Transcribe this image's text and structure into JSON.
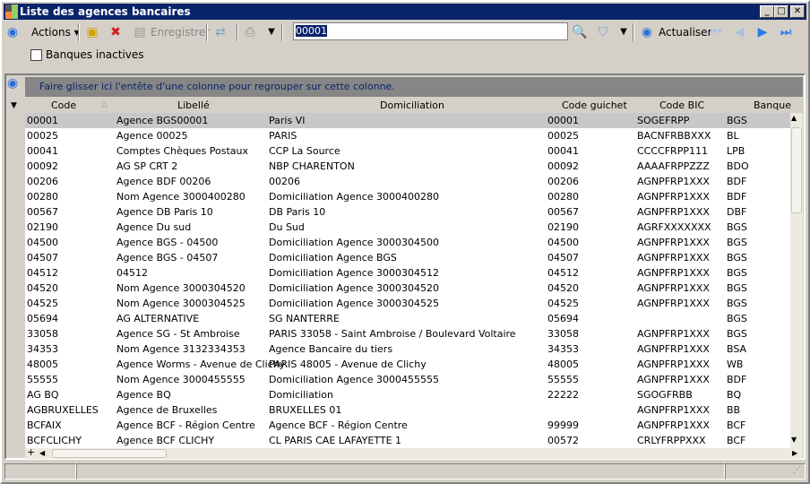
{
  "window": {
    "title": "Liste des agences bancaires"
  },
  "toolbar": {
    "actions": "Actions",
    "save": "Enregistrer",
    "search_value": "00001",
    "refresh": "Actualiser"
  },
  "filter": {
    "inactive_label": "Banques inactives",
    "inactive_checked": false
  },
  "grid": {
    "group_hint": "Faire glisser ici l'entête d'une colonne pour regrouper sur cette colonne.",
    "columns": [
      "Code",
      "Libellé",
      "Domiciliation",
      "Code guichet",
      "Code BIC",
      "Banque"
    ],
    "rows": [
      [
        "00001",
        "Agence BGS00001",
        "Paris VI",
        "00001",
        "SOGEFRPP",
        "BGS"
      ],
      [
        "00025",
        "Agence 00025",
        "PARIS",
        "00025",
        "BACNFRBBXXX",
        "BL"
      ],
      [
        "00041",
        "Comptes Chèques Postaux",
        "CCP La Source",
        "00041",
        "CCCCFRPP111",
        "LPB"
      ],
      [
        "00092",
        "AG SP CRT 2",
        "NBP CHARENTON",
        "00092",
        "AAAAFRPPZZZ",
        "BDO"
      ],
      [
        "00206",
        "Agence BDF 00206",
        "00206",
        "00206",
        "AGNPFRP1XXX",
        "BDF"
      ],
      [
        "00280",
        "Nom Agence 3000400280",
        "Domiciliation Agence 3000400280",
        "00280",
        "AGNPFRP1XXX",
        "BDF"
      ],
      [
        "00567",
        "Agence DB Paris 10",
        "DB Paris 10",
        "00567",
        "AGNPFRP1XXX",
        "DBF"
      ],
      [
        "02190",
        "Agence  Du sud",
        "Du Sud",
        "02190",
        "AGRFXXXXXXX",
        "BGS"
      ],
      [
        "04500",
        "Agence BGS - 04500",
        "Domiciliation Agence 3000304500",
        "04500",
        "AGNPFRP1XXX",
        "BGS"
      ],
      [
        "04507",
        "Agence BGS - 04507",
        "Domiciliation Agence BGS",
        "04507",
        "AGNPFRP1XXX",
        "BGS"
      ],
      [
        "04512",
        "04512",
        "Domiciliation Agence 3000304512",
        "04512",
        "AGNPFRP1XXX",
        "BGS"
      ],
      [
        "04520",
        "Nom Agence 3000304520",
        "Domiciliation Agence 3000304520",
        "04520",
        "AGNPFRP1XXX",
        "BGS"
      ],
      [
        "04525",
        "Nom Agence 3000304525",
        "Domiciliation Agence 3000304525",
        "04525",
        "AGNPFRP1XXX",
        "BGS"
      ],
      [
        "05694",
        "AG ALTERNATIVE",
        "SG NANTERRE",
        "05694",
        "",
        "BGS"
      ],
      [
        "33058",
        "Agence SG - St Ambroise",
        "PARIS 33058 - Saint Ambroise / Boulevard Voltaire",
        "33058",
        "AGNPFRP1XXX",
        "BGS"
      ],
      [
        "34353",
        "Nom Agence 3132334353",
        "Agence Bancaire du tiers",
        "34353",
        "AGNPFRP1XXX",
        "BSA"
      ],
      [
        "48005",
        "Agence Worms - Avenue de Clichy",
        "PARIS 48005 - Avenue de Clichy",
        "48005",
        "AGNPFRP1XXX",
        "WB"
      ],
      [
        "55555",
        "Nom Agence 3000455555",
        "Domiciliation Agence 3000455555",
        "55555",
        "AGNPFRP1XXX",
        "BDF"
      ],
      [
        "AG BQ",
        "Agence BQ",
        "Domiciliation",
        "22222",
        "SGOGFRBB",
        "BQ"
      ],
      [
        "AGBRUXELLES",
        "Agence de Bruxelles",
        "BRUXELLES 01",
        "",
        "AGNPFRP1XXX",
        "BB"
      ],
      [
        "BCFAIX",
        "Agence BCF - Région Centre",
        "Agence BCF - Région Centre",
        "99999",
        "AGNPFRP1XXX",
        "BCF"
      ],
      [
        "BCFCLICHY",
        "Agence BCF CLICHY",
        "CL PARIS CAE LAFAYETTE 1",
        "00572",
        "CRLYFRPPXXX",
        "BCF"
      ]
    ],
    "selected_row": 0
  }
}
